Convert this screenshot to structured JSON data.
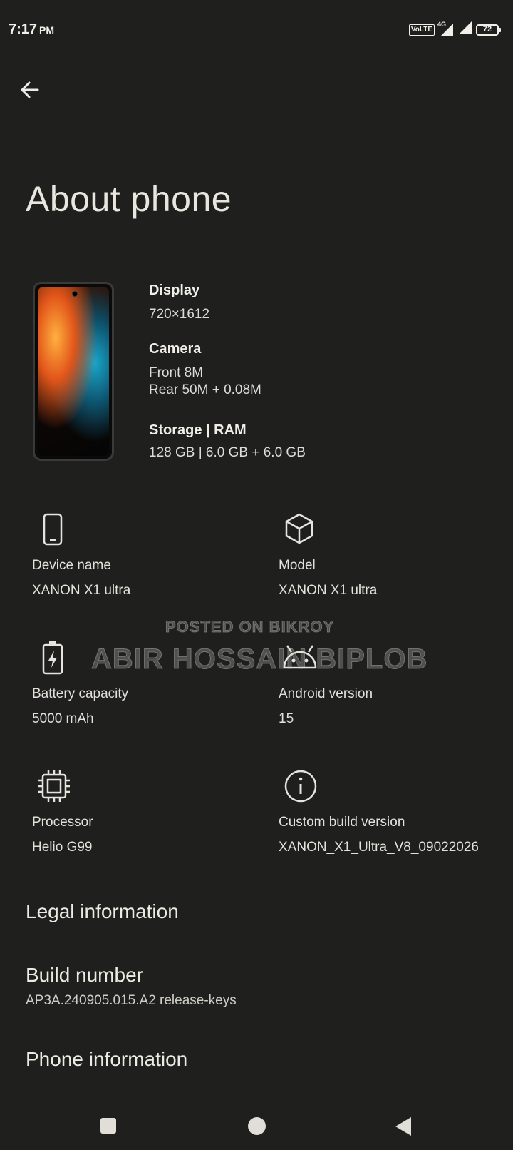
{
  "status_bar": {
    "time": "7:17",
    "ampm": "PM",
    "volte": "VoLTE",
    "network": "4G",
    "battery": "72"
  },
  "page": {
    "title": "About phone"
  },
  "specs": {
    "display_label": "Display",
    "display_value": "720×1612",
    "camera_label": "Camera",
    "camera_front": "Front 8M",
    "camera_rear": "Rear 50M + 0.08M",
    "storage_label": "Storage | RAM",
    "storage_value": "128 GB | 6.0 GB + 6.0 GB"
  },
  "cards": [
    {
      "label": "Device name",
      "value": "XANON X1 ultra",
      "icon": "phone-icon"
    },
    {
      "label": "Model",
      "value": "XANON X1 ultra",
      "icon": "cube-icon"
    },
    {
      "label": "Battery capacity",
      "value": "5000 mAh",
      "icon": "battery-icon"
    },
    {
      "label": "Android version",
      "value": "15",
      "icon": "android-icon"
    },
    {
      "label": "Processor",
      "value": "Helio G99",
      "icon": "chip-icon"
    },
    {
      "label": "Custom build version",
      "value": "XANON_X1_Ultra_V8_09022026",
      "icon": "info-icon"
    }
  ],
  "list": {
    "legal": "Legal information",
    "build_title": "Build number",
    "build_value": "AP3A.240905.015.A2 release-keys",
    "phone_info": "Phone information"
  },
  "watermark": {
    "line1": "POSTED ON BIKROY",
    "line2": "ABIR HOSSAIN BIPLOB"
  },
  "colors": {
    "background": "#1f201e",
    "text": "#e6e4dc"
  }
}
